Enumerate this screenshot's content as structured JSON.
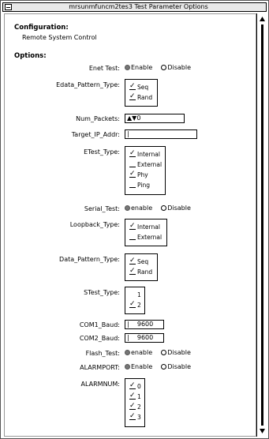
{
  "window": {
    "title": "mrsunmfuncm2tes3 Test Parameter Options"
  },
  "configuration": {
    "heading": "Configuration:",
    "value": "Remote System Control"
  },
  "options": {
    "heading": "Options:",
    "enet_test": {
      "label": "Enet Test:",
      "enable": "Enable",
      "disable": "Disable"
    },
    "edata_pattern": {
      "label": "Edata_Pattern_Type:",
      "items": [
        "Seq",
        "Rand"
      ]
    },
    "num_packets": {
      "label": "Num_Packets:",
      "value": "0"
    },
    "target_ip": {
      "label": "Target_IP_Addr:",
      "value": "|"
    },
    "etest_type": {
      "label": "ETest_Type:",
      "items": [
        "Internal",
        "External",
        "Phy",
        "Ping"
      ]
    },
    "serial_test": {
      "label": "Serial_Test:",
      "enable": "enable",
      "disable": "Disable"
    },
    "loopback_type": {
      "label": "Loopback_Type:",
      "items": [
        "Internal",
        "External"
      ]
    },
    "data_pattern": {
      "label": "Data_Pattern_Type:",
      "items": [
        "Seq",
        "Rand"
      ]
    },
    "stest_type": {
      "label": "STest_Type:",
      "items": [
        "1",
        "2"
      ]
    },
    "com1_baud": {
      "label": "COM1_Baud:",
      "value": "9600"
    },
    "com2_baud": {
      "label": "COM2_Baud:",
      "value": "9600"
    },
    "flash_test": {
      "label": "Flash_Test:",
      "enable": "enable",
      "disable": "Disable"
    },
    "alarmport": {
      "label": "ALARMPORT:",
      "enable": "Enable",
      "disable": "Disable"
    },
    "alarmnum": {
      "label": "ALARMNUM:",
      "items": [
        "0",
        "1",
        "2",
        "3"
      ]
    }
  }
}
